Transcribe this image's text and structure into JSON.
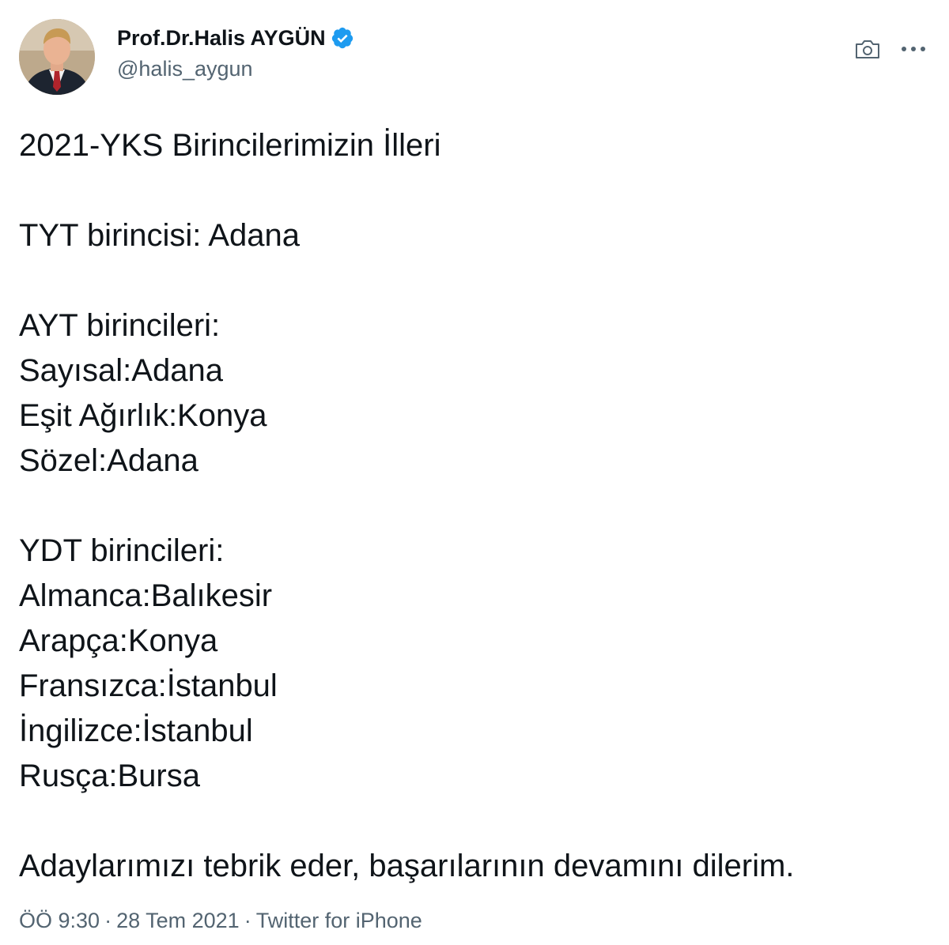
{
  "author": {
    "display_name": "Prof.Dr.Halis AYGÜN",
    "handle": "@halis_aygun",
    "verified": true,
    "verified_color": "#1d9bf0",
    "avatar_icon": "profile-photo"
  },
  "header_actions": {
    "camera_icon": "camera-icon",
    "more_icon": "more-horizontal-icon"
  },
  "tweet": {
    "lines": [
      "2021-YKS Birincilerimizin İlleri",
      "",
      "TYT birincisi: Adana",
      "",
      "AYT birincileri:",
      "Sayısal:Adana",
      "Eşit Ağırlık:Konya",
      "Sözel:Adana",
      "",
      "YDT birincileri:",
      "Almanca:Balıkesir",
      "Arapça:Konya",
      "Fransızca:İstanbul",
      "İngilizce:İstanbul",
      "Rusça:Bursa",
      "",
      "Adaylarımızı tebrik eder, başarılarının devamını dilerim."
    ]
  },
  "meta": {
    "time": "ÖÖ 9:30",
    "separator": "·",
    "date": "28 Tem 2021",
    "source": "Twitter for iPhone"
  },
  "colors": {
    "text": "#0f1419",
    "secondary": "#536471",
    "accent": "#1d9bf0"
  }
}
